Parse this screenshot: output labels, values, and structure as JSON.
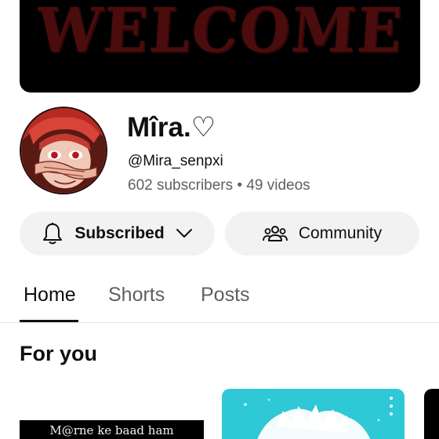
{
  "banner": {
    "text": "WELCOME"
  },
  "channel": {
    "name": "Mîra.♡",
    "handle": "@Mira_senpxi",
    "subscribers": "602 subscribers",
    "separator": "•",
    "videos": "49 videos"
  },
  "actions": {
    "subscribed_label": "Subscribed",
    "community_label": "Community"
  },
  "tabs": [
    {
      "label": "Home",
      "active": true
    },
    {
      "label": "Shorts",
      "active": false
    },
    {
      "label": "Posts",
      "active": false
    }
  ],
  "section": {
    "title": "For you"
  },
  "cards": [
    {
      "caption": "M@rne ke baad ham"
    },
    {
      "caption": ""
    }
  ],
  "icons": {
    "subscribed": "bell-icon",
    "dropdown": "chevron-down-icon",
    "community": "people-icon",
    "more": "more-vertical-icon"
  },
  "colors": {
    "banner_bg": "#000000",
    "banner_text": "#4a0c0c",
    "button_bg": "#f2f2f2",
    "secondary_text": "#606060",
    "card_teal": "#2ec8d6"
  }
}
